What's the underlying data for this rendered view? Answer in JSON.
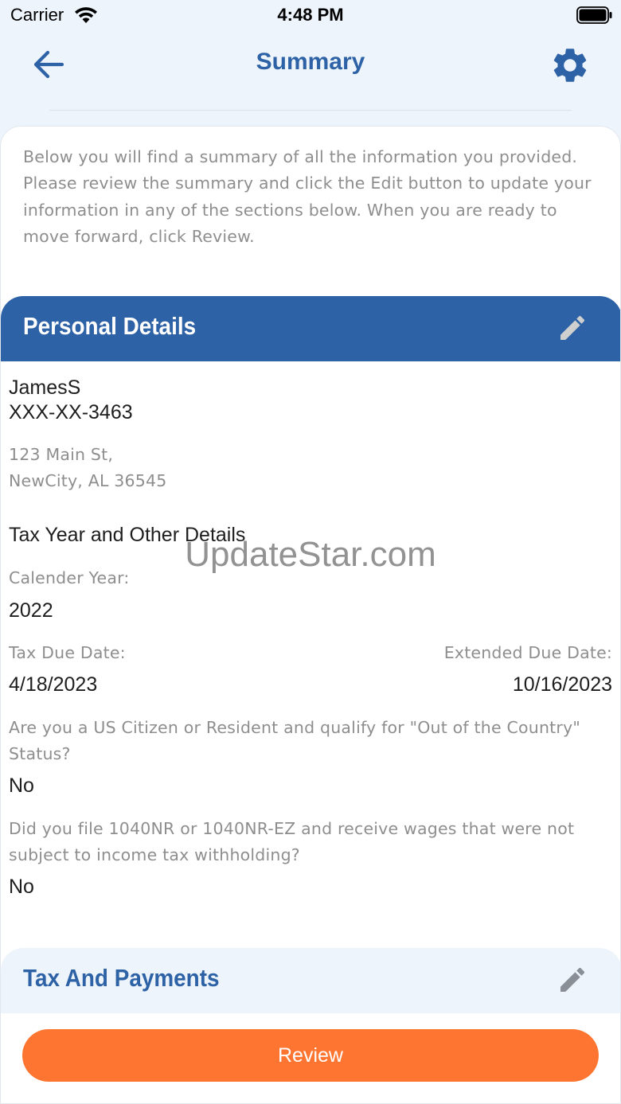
{
  "status_bar": {
    "carrier": "Carrier",
    "time": "4:48 PM"
  },
  "nav": {
    "title": "Summary",
    "back_icon": "arrow-left-icon",
    "settings_icon": "gear-icon"
  },
  "intro_text": "Below you will find a summary of all the information you provided. Please review the summary and click the Edit button to update your information in any of the sections below. When you are ready to move forward, click Review.",
  "personal_details": {
    "title": "Personal Details",
    "edit_icon": "pencil-icon",
    "name": "JamesS",
    "ssn": "XXX-XX-3463",
    "address_line1": "123 Main St,",
    "address_line2": "NewCity, AL 36545",
    "tax_year_heading": "Tax Year and Other Details",
    "calendar_year_label": "Calender Year:",
    "calendar_year_value": "2022",
    "tax_due_label": "Tax Due Date:",
    "tax_due_value": "4/18/2023",
    "extended_due_label": "Extended Due Date:",
    "extended_due_value": "10/16/2023",
    "question1": "Are you a US Citizen or Resident and qualify for \"Out of the Country\" Status?",
    "answer1": "No",
    "question2": "Did you file 1040NR or 1040NR-EZ and receive wages that were not subject to income tax withholding?",
    "answer2": "No"
  },
  "tax_and_payments": {
    "title": "Tax And Payments",
    "edit_icon": "pencil-icon"
  },
  "watermark": "UpdateStar.com",
  "review_button": {
    "label": "Review"
  },
  "colors": {
    "brand_blue": "#2e62a6",
    "review_orange": "#fd7530",
    "background": "#eef4fb"
  }
}
